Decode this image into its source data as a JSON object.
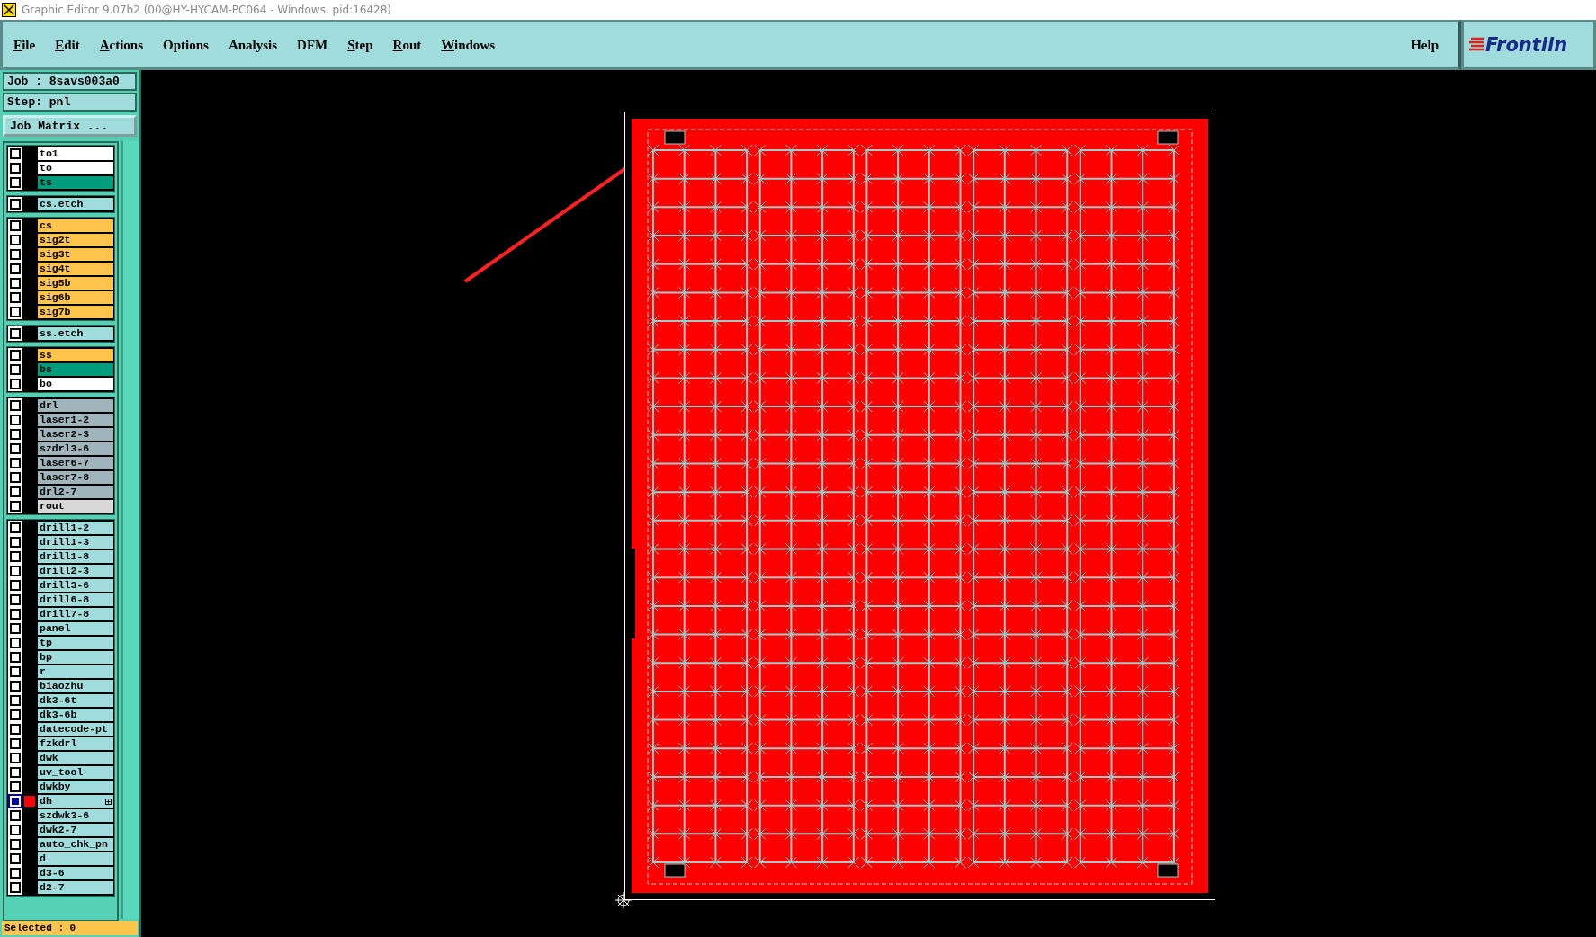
{
  "window": {
    "title": "Graphic Editor 9.07b2 (00@HY-HYCAM-PC064 - Windows, pid:16428)"
  },
  "menu": [
    {
      "label": "File",
      "mnemonic": true
    },
    {
      "label": "Edit",
      "mnemonic": true
    },
    {
      "label": "Actions",
      "mnemonic": true
    },
    {
      "label": "Options",
      "mnemonic": false
    },
    {
      "label": "Analysis",
      "mnemonic": false
    },
    {
      "label": "DFM",
      "mnemonic": false
    },
    {
      "label": "Step",
      "mnemonic": true
    },
    {
      "label": "Rout",
      "mnemonic": true
    },
    {
      "label": "Windows",
      "mnemonic": true
    }
  ],
  "help": "Help",
  "logo": "Frontlin",
  "job": "Job : 8savs003a0",
  "step": "Step: pnl",
  "job_matrix_button": "Job Matrix ...",
  "layer_groups": [
    [
      {
        "name": "to1",
        "color": "#ffffff",
        "affected": false,
        "displayed": false
      },
      {
        "name": "to",
        "color": "#ffffff",
        "affected": false,
        "displayed": false
      },
      {
        "name": "ts",
        "color": "#009c7c",
        "affected": false,
        "displayed": false
      }
    ],
    [
      {
        "name": "cs.etch",
        "color": "#a0dcdc",
        "affected": false,
        "displayed": false
      }
    ],
    [
      {
        "name": "cs",
        "color": "#ffc44c",
        "affected": false,
        "displayed": false
      },
      {
        "name": "sig2t",
        "color": "#ffc44c",
        "affected": false,
        "displayed": false
      },
      {
        "name": "sig3t",
        "color": "#ffc44c",
        "affected": false,
        "displayed": false
      },
      {
        "name": "sig4t",
        "color": "#ffc44c",
        "affected": false,
        "displayed": false
      },
      {
        "name": "sig5b",
        "color": "#ffc44c",
        "affected": false,
        "displayed": false
      },
      {
        "name": "sig6b",
        "color": "#ffc44c",
        "affected": false,
        "displayed": false
      },
      {
        "name": "sig7b",
        "color": "#ffc44c",
        "affected": false,
        "displayed": false
      }
    ],
    [
      {
        "name": "ss.etch",
        "color": "#a0dcdc",
        "affected": false,
        "displayed": false
      }
    ],
    [
      {
        "name": "ss",
        "color": "#ffc44c",
        "affected": false,
        "displayed": false
      },
      {
        "name": "bs",
        "color": "#009c7c",
        "affected": false,
        "displayed": false
      },
      {
        "name": "bo",
        "color": "#ffffff",
        "affected": false,
        "displayed": false
      }
    ],
    [
      {
        "name": "drl",
        "color": "#a0b4bc",
        "affected": false,
        "displayed": false
      },
      {
        "name": "laser1-2",
        "color": "#a0b4bc",
        "affected": false,
        "displayed": false
      },
      {
        "name": "laser2-3",
        "color": "#a0b4bc",
        "affected": false,
        "displayed": false
      },
      {
        "name": "szdrl3-6",
        "color": "#a0b4bc",
        "affected": false,
        "displayed": false
      },
      {
        "name": "laser6-7",
        "color": "#a0b4bc",
        "affected": false,
        "displayed": false
      },
      {
        "name": "laser7-8",
        "color": "#a0b4bc",
        "affected": false,
        "displayed": false
      },
      {
        "name": "drl2-7",
        "color": "#a0b4bc",
        "affected": false,
        "displayed": false
      },
      {
        "name": "rout",
        "color": "#d8d8d8",
        "affected": false,
        "displayed": false
      }
    ],
    [
      {
        "name": "drill1-2",
        "color": "#a0dcdc",
        "affected": false,
        "displayed": false
      },
      {
        "name": "drill1-3",
        "color": "#a0dcdc",
        "affected": false,
        "displayed": false
      },
      {
        "name": "drill1-8",
        "color": "#a0dcdc",
        "affected": false,
        "displayed": false
      },
      {
        "name": "drill2-3",
        "color": "#a0dcdc",
        "affected": false,
        "displayed": false
      },
      {
        "name": "drill3-6",
        "color": "#a0dcdc",
        "affected": false,
        "displayed": false
      },
      {
        "name": "drill6-8",
        "color": "#a0dcdc",
        "affected": false,
        "displayed": false
      },
      {
        "name": "drill7-8",
        "color": "#a0dcdc",
        "affected": false,
        "displayed": false
      },
      {
        "name": "panel",
        "color": "#a0dcdc",
        "affected": false,
        "displayed": false
      },
      {
        "name": "tp",
        "color": "#a0dcdc",
        "affected": false,
        "displayed": false
      },
      {
        "name": "bp",
        "color": "#a0dcdc",
        "affected": false,
        "displayed": false
      },
      {
        "name": "r",
        "color": "#a0dcdc",
        "affected": false,
        "displayed": false
      },
      {
        "name": "biaozhu",
        "color": "#a0dcdc",
        "affected": false,
        "displayed": false
      },
      {
        "name": "dk3-6t",
        "color": "#a0dcdc",
        "affected": false,
        "displayed": false
      },
      {
        "name": "dk3-6b",
        "color": "#a0dcdc",
        "affected": false,
        "displayed": false
      },
      {
        "name": "datecode-pt",
        "color": "#a0dcdc",
        "affected": false,
        "displayed": false
      },
      {
        "name": "fzkdrl",
        "color": "#a0dcdc",
        "affected": false,
        "displayed": false
      },
      {
        "name": "dwk",
        "color": "#a0dcdc",
        "affected": false,
        "displayed": false
      },
      {
        "name": "uv_tool",
        "color": "#a0dcdc",
        "affected": false,
        "displayed": false
      },
      {
        "name": "dwkby",
        "color": "#a0dcdc",
        "affected": false,
        "displayed": false
      },
      {
        "name": "dh",
        "color": "#a0dcdc",
        "affected": true,
        "displayed": true
      },
      {
        "name": "szdwk3-6",
        "color": "#a0dcdc",
        "affected": false,
        "displayed": false
      },
      {
        "name": "dwk2-7",
        "color": "#a0dcdc",
        "affected": false,
        "displayed": false
      },
      {
        "name": "auto_chk_pn",
        "color": "#a0dcdc",
        "affected": false,
        "displayed": false
      },
      {
        "name": "d",
        "color": "#a0dcdc",
        "affected": false,
        "displayed": false
      },
      {
        "name": "d3-6",
        "color": "#a0dcdc",
        "affected": false,
        "displayed": false
      },
      {
        "name": "d2-7",
        "color": "#a0dcdc",
        "affected": false,
        "displayed": false
      }
    ]
  ],
  "status": "Selected : 0"
}
